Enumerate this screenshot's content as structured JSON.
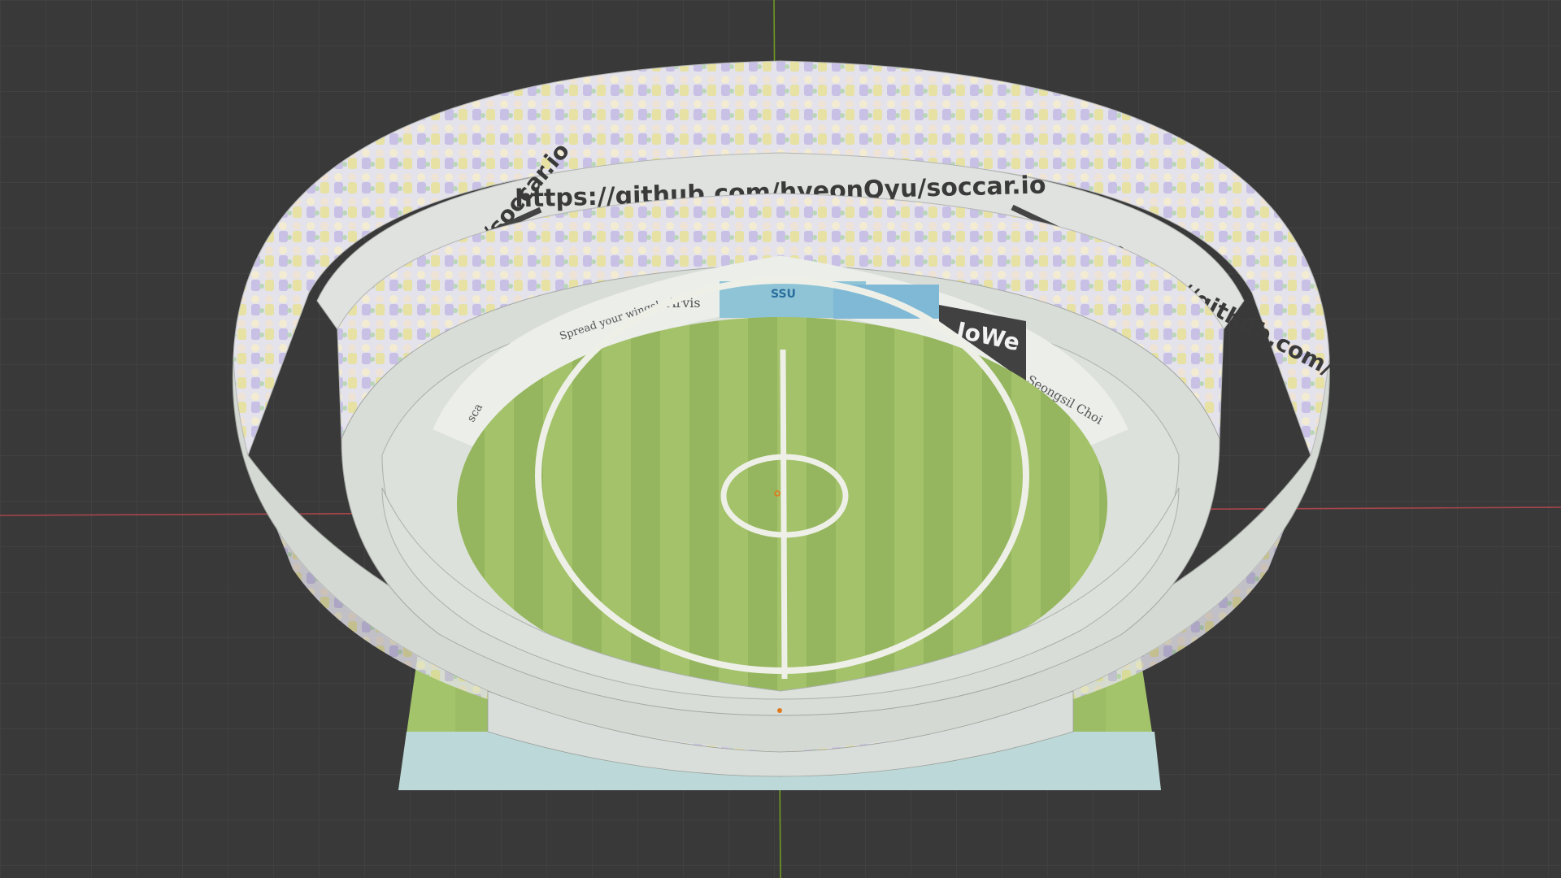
{
  "scene": {
    "banner_url": "https://github.com/hyeonQyu/soccar.io",
    "banner_left_text": "hyeonQyu/soccar.io",
    "banner_right_text": "https://github.com/",
    "sponsors": [
      {
        "label": "Arvis"
      },
      {
        "label": "SSU"
      },
      {
        "label": "IoWe"
      },
      {
        "label": "Spread your wings!"
      },
      {
        "label": "Seongsil Choi"
      },
      {
        "label": "sca"
      }
    ]
  },
  "colors": {
    "background": "#393939",
    "grid_line": "#454545",
    "x_axis": "#b5474d",
    "y_axis": "#6a9a1f",
    "pitch_light": "#a3c26a",
    "pitch_dark": "#93b65a",
    "stand_wall": "#d8ddd8",
    "crowd": "#dcd9e8",
    "floor_plate": "#bcd6d6",
    "iowe_bg": "#454545"
  },
  "icons": {
    "origin": "origin-dot-icon",
    "object_origin": "object-origin-icon"
  }
}
